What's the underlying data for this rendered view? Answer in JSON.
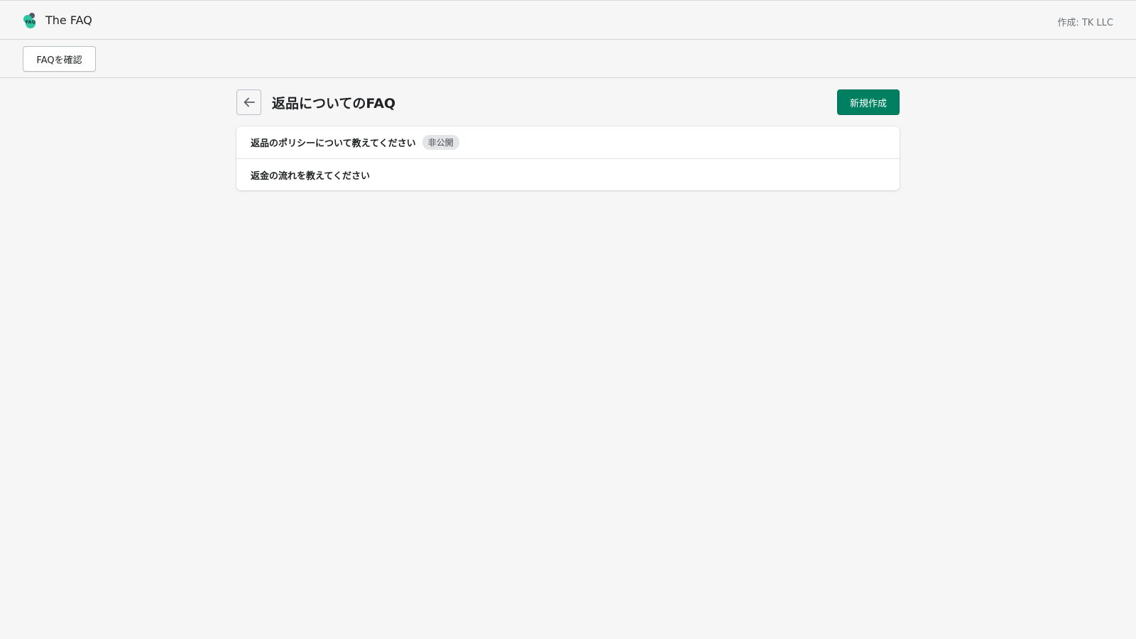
{
  "header": {
    "app_title": "The FAQ",
    "logo_text": "FAQ",
    "author": "作成: TK LLC"
  },
  "actionbar": {
    "view_faq_label": "FAQを確認"
  },
  "page": {
    "title": "返品についてのFAQ",
    "new_button_label": "新規作成"
  },
  "faq_list": [
    {
      "question": "返品のポリシーについて教えてください",
      "badge": "非公開"
    },
    {
      "question": "返金の流れを教えてください",
      "badge": null
    }
  ],
  "colors": {
    "primary": "#008060",
    "logo_accent": "#2ec4a0",
    "background": "#f6f6f7"
  },
  "icons": {
    "back": "arrow-left-icon",
    "logo": "faq-logo-icon"
  }
}
